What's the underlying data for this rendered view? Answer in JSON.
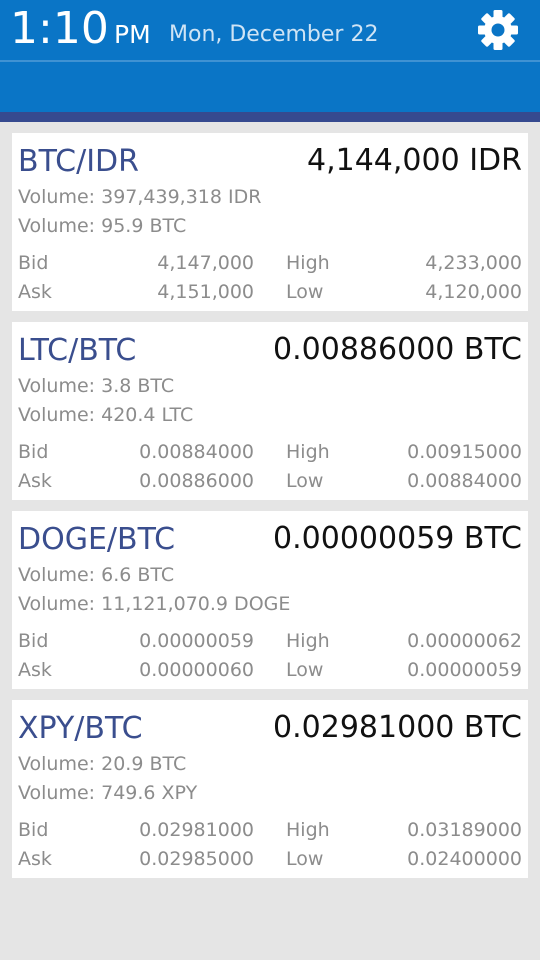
{
  "status": {
    "time": "1:10",
    "ampm": "PM",
    "date": "Mon, December 22"
  },
  "header": {
    "settings_icon": "gear-icon",
    "accent_color": "#0a75c6",
    "band_edge_color": "#364a8f"
  },
  "labels": {
    "bid": "Bid",
    "ask": "Ask",
    "high": "High",
    "low": "Low"
  },
  "markets": [
    {
      "pair": "BTC/IDR",
      "price": "4,144,000 IDR",
      "volume1": "Volume: 397,439,318 IDR",
      "volume2": "Volume: 95.9 BTC",
      "bid": "4,147,000",
      "ask": "4,151,000",
      "high": "4,233,000",
      "low": "4,120,000"
    },
    {
      "pair": "LTC/BTC",
      "price": "0.00886000 BTC",
      "volume1": "Volume: 3.8 BTC",
      "volume2": "Volume: 420.4 LTC",
      "bid": "0.00884000",
      "ask": "0.00886000",
      "high": "0.00915000",
      "low": "0.00884000"
    },
    {
      "pair": "DOGE/BTC",
      "price": "0.00000059 BTC",
      "volume1": "Volume: 6.6 BTC",
      "volume2": "Volume: 11,121,070.9 DOGE",
      "bid": "0.00000059",
      "ask": "0.00000060",
      "high": "0.00000062",
      "low": "0.00000059"
    },
    {
      "pair": "XPY/BTC",
      "price": "0.02981000 BTC",
      "volume1": "Volume: 20.9 BTC",
      "volume2": "Volume: 749.6 XPY",
      "bid": "0.02981000",
      "ask": "0.02985000",
      "high": "0.03189000",
      "low": "0.02400000"
    }
  ]
}
